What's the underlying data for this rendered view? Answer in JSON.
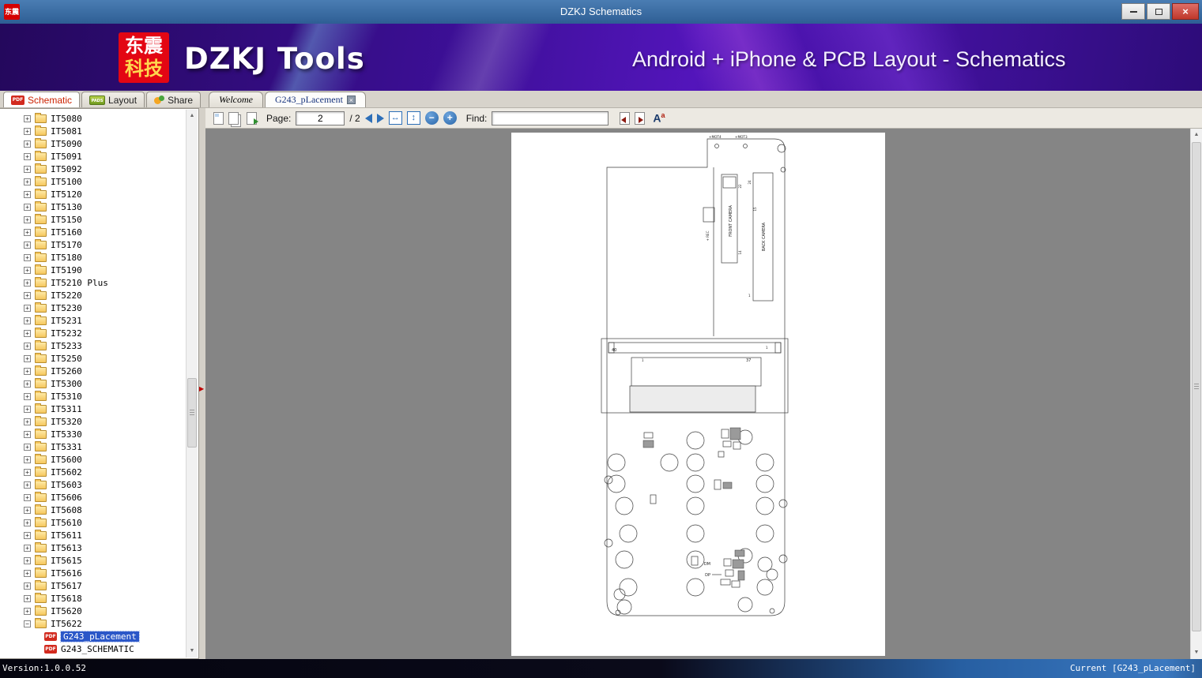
{
  "window": {
    "title": "DZKJ Schematics"
  },
  "banner": {
    "logo_line1": "东震",
    "logo_line2": "科技",
    "app_name": "DZKJ Tools",
    "subtitle": "Android + iPhone & PCB Layout - Schematics"
  },
  "tabs": {
    "schematic": "Schematic",
    "layout": "Layout",
    "share": "Share",
    "welcome": "Welcome",
    "document": "G243_pLacement"
  },
  "icons": {
    "pdf_badge": "PDF",
    "pads_badge": "PADS",
    "close": "×",
    "zoom_out": "−",
    "zoom_in": "+",
    "fit_width": "↔",
    "fit_page": "↕",
    "font_main": "A",
    "font_sup": "a",
    "scroll_up": "▲",
    "scroll_down": "▼",
    "splitter_arrow": "▶",
    "expand": "+",
    "collapse": "−"
  },
  "toolbar": {
    "page_label": "Page:",
    "page_value": "2",
    "page_total": "/ 2",
    "find_label": "Find:",
    "find_value": ""
  },
  "sidebar": {
    "items": [
      "IT5080",
      "IT5081",
      "IT5090",
      "IT5091",
      "IT5092",
      "IT5100",
      "IT5120",
      "IT5130",
      "IT5150",
      "IT5160",
      "IT5170",
      "IT5180",
      "IT5190",
      "IT5210 Plus",
      "IT5220",
      "IT5230",
      "IT5231",
      "IT5232",
      "IT5233",
      "IT5250",
      "IT5260",
      "IT5300",
      "IT5310",
      "IT5311",
      "IT5320",
      "IT5330",
      "IT5331",
      "IT5600",
      "IT5602",
      "IT5603",
      "IT5606",
      "IT5608",
      "IT5610",
      "IT5611",
      "IT5613",
      "IT5615",
      "IT5616",
      "IT5617",
      "IT5618",
      "IT5620",
      "IT5622"
    ],
    "expanded": "IT5622",
    "children": [
      {
        "label": "G243_pLacement",
        "selected": true
      },
      {
        "label": "G243_SCHEMATIC",
        "selected": false
      }
    ]
  },
  "drawing": {
    "labels": {
      "mot4": "+MOT4",
      "mot3": "+MOT3",
      "front_camera": "FRONT CAMERA",
      "back_camera": "BACK CAMERA",
      "rec": "+ REC",
      "pin22": "22",
      "pin24": "24",
      "pin15": "15",
      "pin14": "14",
      "pin40": "40",
      "pin37": "37",
      "pin1a": "1",
      "pin1b": "1",
      "pin1c": "1",
      "dm": "DM",
      "dp": "DP"
    }
  },
  "statusbar": {
    "version": "Version:1.0.0.52",
    "current": "Current [G243_pLacement]"
  }
}
